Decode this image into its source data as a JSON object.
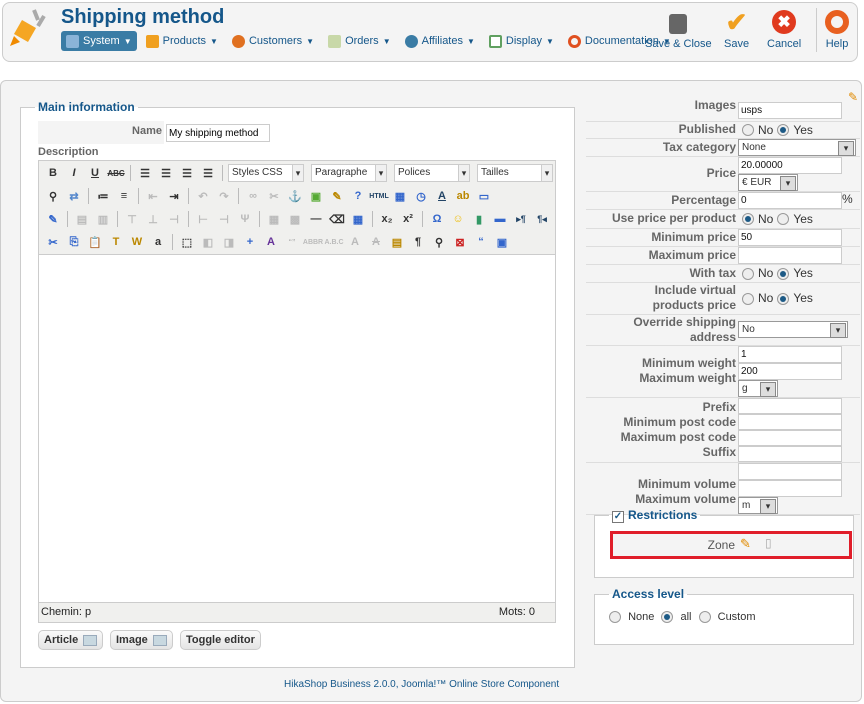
{
  "header": {
    "title": "Shipping method",
    "menu": [
      {
        "label": "System",
        "icon": "tools-icon",
        "color": "#5a8fc0"
      },
      {
        "label": "Products",
        "icon": "box-icon",
        "color": "#f0a020"
      },
      {
        "label": "Customers",
        "icon": "user-icon",
        "color": "#e07020"
      },
      {
        "label": "Orders",
        "icon": "document-icon",
        "color": "#9ab070"
      },
      {
        "label": "Affiliates",
        "icon": "affiliate-icon",
        "color": "#3a7ca5"
      },
      {
        "label": "Display",
        "icon": "display-icon",
        "color": "#60a060"
      },
      {
        "label": "Documentation",
        "icon": "lifebuoy-icon",
        "color": "#e05020"
      }
    ],
    "toolbar": {
      "save_close": "Save & Close",
      "save": "Save",
      "cancel": "Cancel",
      "help": "Help"
    }
  },
  "main_info": {
    "legend": "Main information",
    "name_label": "Name",
    "name_value": "My shipping method",
    "description_label": "Description",
    "editor": {
      "styles": "Styles CSS",
      "format": "Paragraphe",
      "font": "Polices",
      "size": "Tailles",
      "path": "Chemin: p",
      "words": "Mots: 0"
    },
    "buttons": {
      "article": "Article",
      "image": "Image",
      "toggle": "Toggle editor"
    }
  },
  "fields": {
    "images": {
      "label": "Images",
      "value": "usps"
    },
    "published": {
      "label": "Published",
      "value": "Yes"
    },
    "tax_category": {
      "label": "Tax category",
      "value": "None"
    },
    "price": {
      "label": "Price",
      "value": "20.00000",
      "currency": "€ EUR"
    },
    "percentage": {
      "label": "Percentage",
      "value": "0",
      "suffix": "%"
    },
    "use_price_per_product": {
      "label": "Use price per product",
      "value": "No"
    },
    "min_price": {
      "label": "Minimum price",
      "value": "50"
    },
    "max_price": {
      "label": "Maximum price",
      "value": ""
    },
    "with_tax": {
      "label": "With tax",
      "value": "Yes"
    },
    "include_virtual": {
      "label": "Include virtual products price",
      "value": "Yes"
    },
    "override_address": {
      "label": "Override shipping address",
      "value": "No"
    },
    "min_weight": {
      "label": "Minimum weight",
      "value": "1"
    },
    "max_weight": {
      "label": "Maximum weight",
      "value": "200"
    },
    "weight_unit": "g",
    "prefix": {
      "label": "Prefix"
    },
    "min_post": {
      "label": "Minimum post code"
    },
    "max_post": {
      "label": "Maximum post code"
    },
    "suffix": {
      "label": "Suffix"
    },
    "min_volume": {
      "label": "Minimum volume"
    },
    "max_volume": {
      "label": "Maximum volume"
    },
    "volume_unit": "m",
    "no": "No",
    "yes": "Yes"
  },
  "restrictions": {
    "legend": "Restrictions",
    "checked": true,
    "zone_label": "Zone"
  },
  "access": {
    "legend": "Access level",
    "options": [
      "None",
      "all",
      "Custom"
    ],
    "selected": "all"
  },
  "footer": "HikaShop Business 2.0.0, Joomla!™ Online Store Component"
}
